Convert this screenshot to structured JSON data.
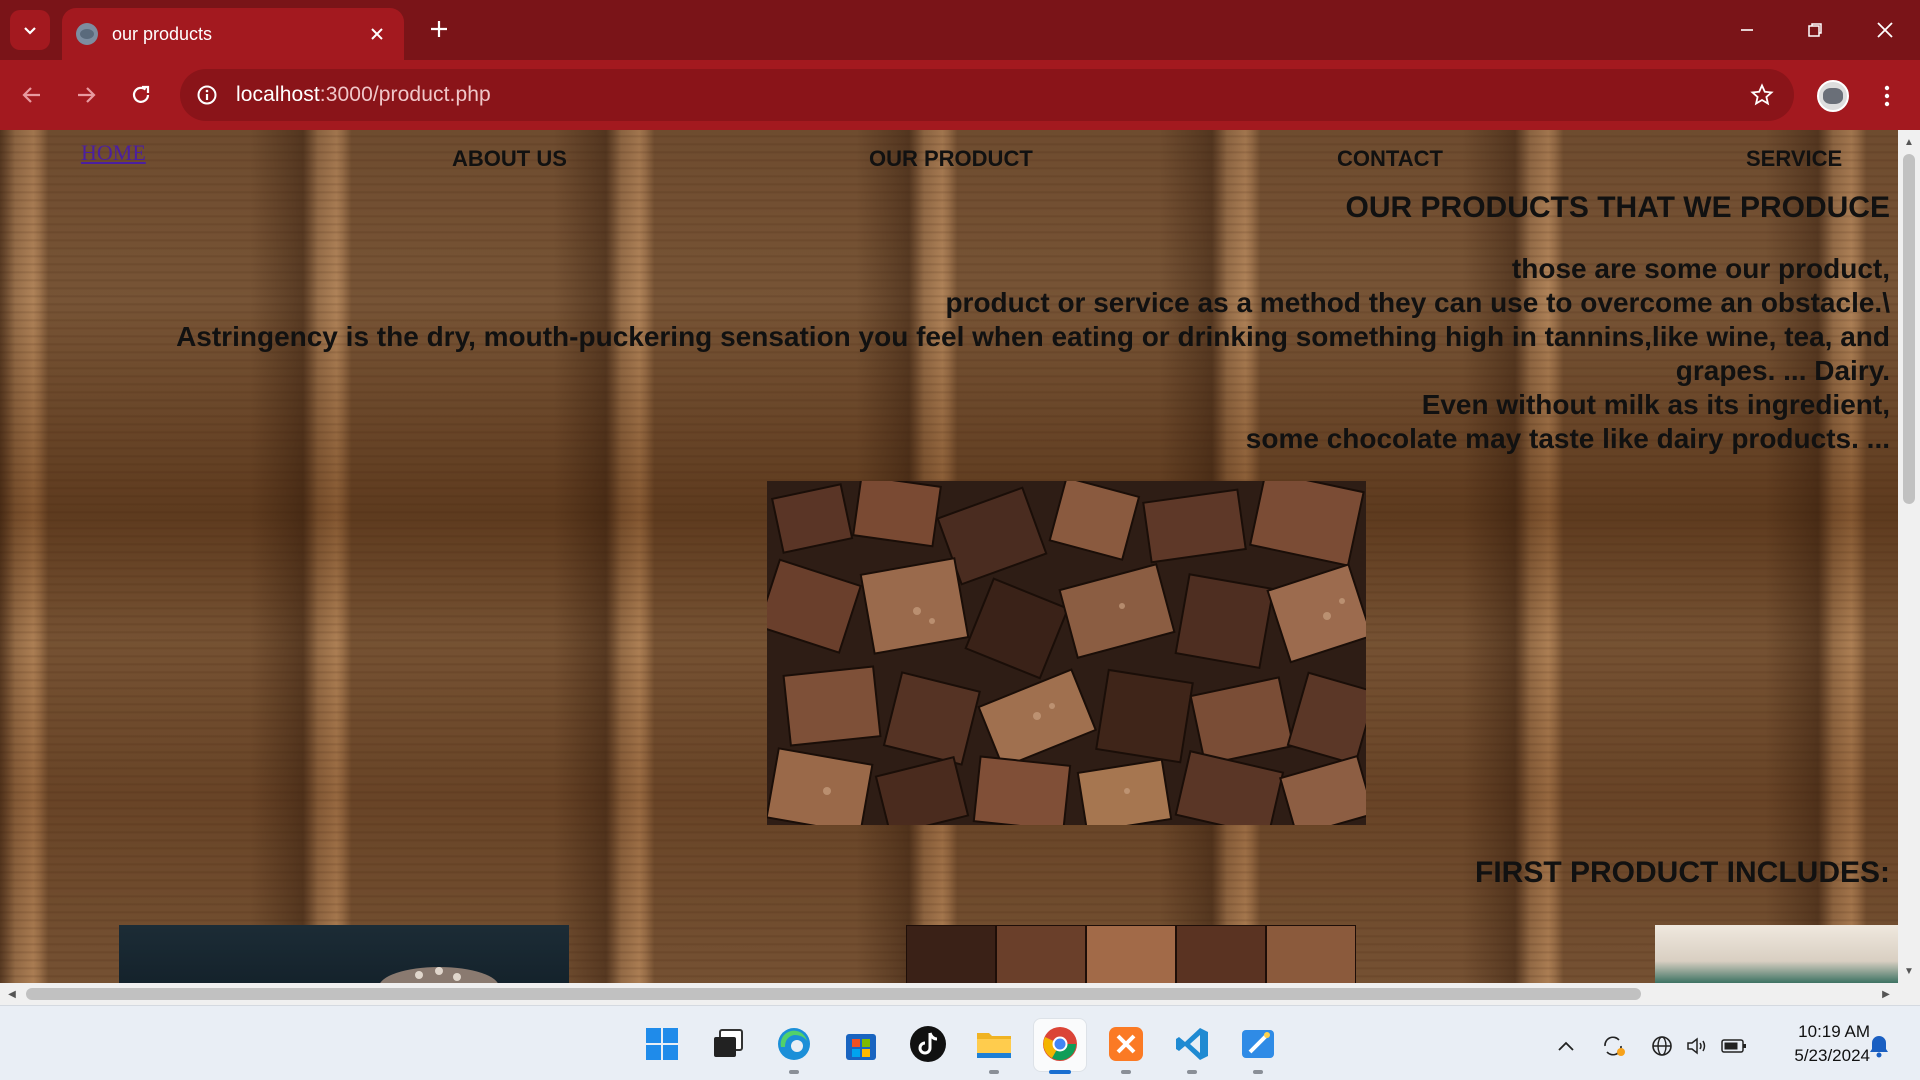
{
  "browser": {
    "tab_title": "our products",
    "url_host": "localhost",
    "url_path": ":3000/product.php"
  },
  "site_nav": {
    "home": "HOME",
    "about": "ABOUT US",
    "product": "OUR PRODUCT",
    "contact": "CONTACT",
    "service": "SERVICE"
  },
  "page": {
    "heading": "OUR PRODUCTS THAT WE PRODUCE",
    "lines": [
      "those are some our product,",
      "product or service as a method they can use to overcome an obstacle.\\",
      "Astringency is the dry, mouth-puckering sensation you feel when eating or drinking something high in tannins,like wine, tea, and",
      "grapes. ... Dairy.",
      "Even without milk as its ingredient,",
      "some chocolate may taste like dairy products. ..."
    ],
    "first_product_heading": "FIRST PRODUCT INCLUDES:"
  },
  "taskbar": {
    "time": "10:19 AM",
    "date": "5/23/2024"
  },
  "colors": {
    "chrome_dark": "#7a1418",
    "chrome_light": "#a3191f",
    "link": "#4b1fa0"
  }
}
